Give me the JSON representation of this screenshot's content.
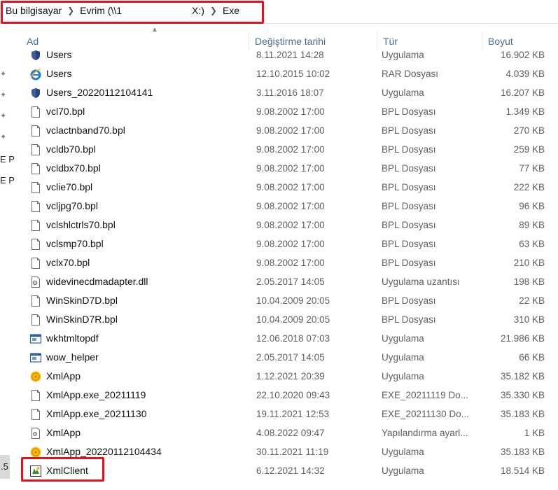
{
  "breadcrumb": {
    "items": [
      "Bu bilgisayar",
      "Evrim (\\\\1",
      "X:)",
      "Exe"
    ]
  },
  "nav": {
    "fragments": [
      "E P",
      "E P"
    ],
    "selected_fragment": ".5"
  },
  "columns": {
    "name": "Ad",
    "modified": "Değiştirme tarihi",
    "type": "Tür",
    "size": "Boyut"
  },
  "files": [
    {
      "name": "Users",
      "date": "8.11.2021 14:28",
      "type": "Uygulama",
      "size": "16.902 KB",
      "icon": "app-shield-icon"
    },
    {
      "name": "Users",
      "date": "12.10.2015 10:02",
      "type": "RAR Dosyası",
      "size": "4.039 KB",
      "icon": "ie-icon"
    },
    {
      "name": "Users_20220112104141",
      "date": "3.11.2016 18:07",
      "type": "Uygulama",
      "size": "16.207 KB",
      "icon": "app-shield-icon"
    },
    {
      "name": "vcl70.bpl",
      "date": "9.08.2002 17:00",
      "type": "BPL Dosyası",
      "size": "1.349 KB",
      "icon": "file-icon"
    },
    {
      "name": "vclactnband70.bpl",
      "date": "9.08.2002 17:00",
      "type": "BPL Dosyası",
      "size": "270 KB",
      "icon": "file-icon"
    },
    {
      "name": "vcldb70.bpl",
      "date": "9.08.2002 17:00",
      "type": "BPL Dosyası",
      "size": "259 KB",
      "icon": "file-icon"
    },
    {
      "name": "vcldbx70.bpl",
      "date": "9.08.2002 17:00",
      "type": "BPL Dosyası",
      "size": "77 KB",
      "icon": "file-icon"
    },
    {
      "name": "vclie70.bpl",
      "date": "9.08.2002 17:00",
      "type": "BPL Dosyası",
      "size": "222 KB",
      "icon": "file-icon"
    },
    {
      "name": "vcljpg70.bpl",
      "date": "9.08.2002 17:00",
      "type": "BPL Dosyası",
      "size": "96 KB",
      "icon": "file-icon"
    },
    {
      "name": "vclshlctrls70.bpl",
      "date": "9.08.2002 17:00",
      "type": "BPL Dosyası",
      "size": "89 KB",
      "icon": "file-icon"
    },
    {
      "name": "vclsmp70.bpl",
      "date": "9.08.2002 17:00",
      "type": "BPL Dosyası",
      "size": "63 KB",
      "icon": "file-icon"
    },
    {
      "name": "vclx70.bpl",
      "date": "9.08.2002 17:00",
      "type": "BPL Dosyası",
      "size": "210 KB",
      "icon": "file-icon"
    },
    {
      "name": "widevinecdmadapter.dll",
      "date": "2.05.2017 14:05",
      "type": "Uygulama uzantısı",
      "size": "198 KB",
      "icon": "dll-icon"
    },
    {
      "name": "WinSkinD7D.bpl",
      "date": "10.04.2009 20:05",
      "type": "BPL Dosyası",
      "size": "22 KB",
      "icon": "file-icon"
    },
    {
      "name": "WinSkinD7R.bpl",
      "date": "10.04.2009 20:05",
      "type": "BPL Dosyası",
      "size": "310 KB",
      "icon": "file-icon"
    },
    {
      "name": "wkhtmltopdf",
      "date": "12.06.2018 07:03",
      "type": "Uygulama",
      "size": "21.986 KB",
      "icon": "window-app-icon"
    },
    {
      "name": "wow_helper",
      "date": "2.05.2017 14:05",
      "type": "Uygulama",
      "size": "66 KB",
      "icon": "window-app-icon"
    },
    {
      "name": "XmlApp",
      "date": "1.12.2021 20:39",
      "type": "Uygulama",
      "size": "35.182 KB",
      "icon": "xml-app-icon"
    },
    {
      "name": "XmlApp.exe_20211119",
      "date": "22.10.2020 09:43",
      "type": "EXE_20211119 Do...",
      "size": "35.330 KB",
      "icon": "file-icon"
    },
    {
      "name": "XmlApp.exe_20211130",
      "date": "19.11.2021 12:53",
      "type": "EXE_20211130 Do...",
      "size": "35.183 KB",
      "icon": "file-icon"
    },
    {
      "name": "XmlApp",
      "date": "4.08.2022 09:47",
      "type": "Yapılandırma ayarl...",
      "size": "1 KB",
      "icon": "config-icon"
    },
    {
      "name": "XmlApp_20220112104434",
      "date": "30.11.2021 11:19",
      "type": "Uygulama",
      "size": "35.183 KB",
      "icon": "xml-app-icon"
    },
    {
      "name": "XmlClient",
      "date": "6.12.2021 14:32",
      "type": "Uygulama",
      "size": "18.514 KB",
      "icon": "xml-client-icon"
    }
  ],
  "colors": {
    "highlight": "#e8101c",
    "header_text": "#4d6a8f",
    "detail_text": "#5f5f5f"
  }
}
